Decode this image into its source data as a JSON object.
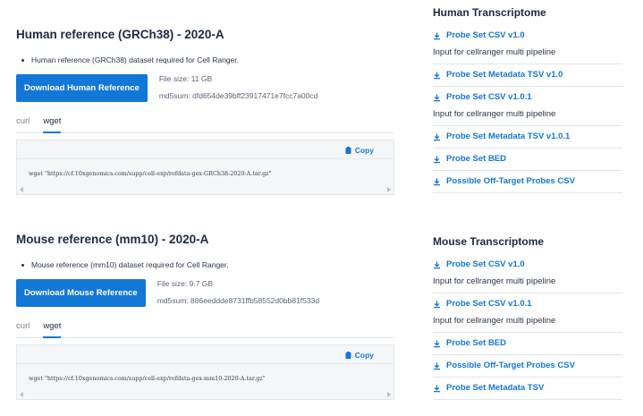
{
  "human": {
    "title": "Human reference (GRCh38) - 2020-A",
    "bullet": "Human reference (GRCh38) dataset required for Cell Ranger.",
    "download_label": "Download Human Reference",
    "file_size": "File size: 11 GB",
    "md5": "md5sum: dfd654de39bff23917471e7fcc7a00cd",
    "tabs": [
      "curl",
      "wget"
    ],
    "active_tab": "wget",
    "copy_label": "Copy",
    "command": "wget \"https://cf.10xgenomics.com/supp/cell-exp/refdata-gex-GRCh38-2020-A.tar.gz\""
  },
  "mouse": {
    "title": "Mouse reference (mm10) - 2020-A",
    "bullet": "Mouse reference (mm10) dataset required for Cell Ranger.",
    "download_label": "Download Mouse Reference",
    "file_size": "File size: 9.7 GB",
    "md5": "md5sum: 886eeddde8731ffb58552d0bb81f533d",
    "tabs": [
      "curl",
      "wget"
    ],
    "active_tab": "wget",
    "copy_label": "Copy",
    "command": "wget \"https://cf.10xgenomics.com/supp/cell-exp/refdata-gex-mm10-2020-A.tar.gz\""
  },
  "human_transcriptome": {
    "title": "Human Transcriptome",
    "links": [
      {
        "label": "Probe Set CSV v1.0",
        "desc": "Input for cellranger multi pipeline"
      },
      {
        "label": "Probe Set Metadata TSV v1.0",
        "desc": ""
      },
      {
        "label": "Probe Set CSV v1.0.1",
        "desc": "Input for cellranger multi pipeline"
      },
      {
        "label": "Probe Set Metadata TSV v1.0.1",
        "desc": ""
      },
      {
        "label": "Probe Set BED",
        "desc": ""
      },
      {
        "label": "Possible Off-Target Probes CSV",
        "desc": ""
      }
    ]
  },
  "mouse_transcriptome": {
    "title": "Mouse Transcriptome",
    "links": [
      {
        "label": "Probe Set CSV v1.0",
        "desc": "Input for cellranger multi pipeline"
      },
      {
        "label": "Probe Set CSV v1.0.1",
        "desc": "Input for cellranger multi pipeline"
      },
      {
        "label": "Probe Set BED",
        "desc": ""
      },
      {
        "label": "Possible Off-Target Probes CSV",
        "desc": ""
      },
      {
        "label": "Probe Set Metadata TSV",
        "desc": ""
      }
    ]
  },
  "colors": {
    "accent": "#1277d6",
    "text": "#1b2a44",
    "code_bg": "#f4f6f8"
  }
}
